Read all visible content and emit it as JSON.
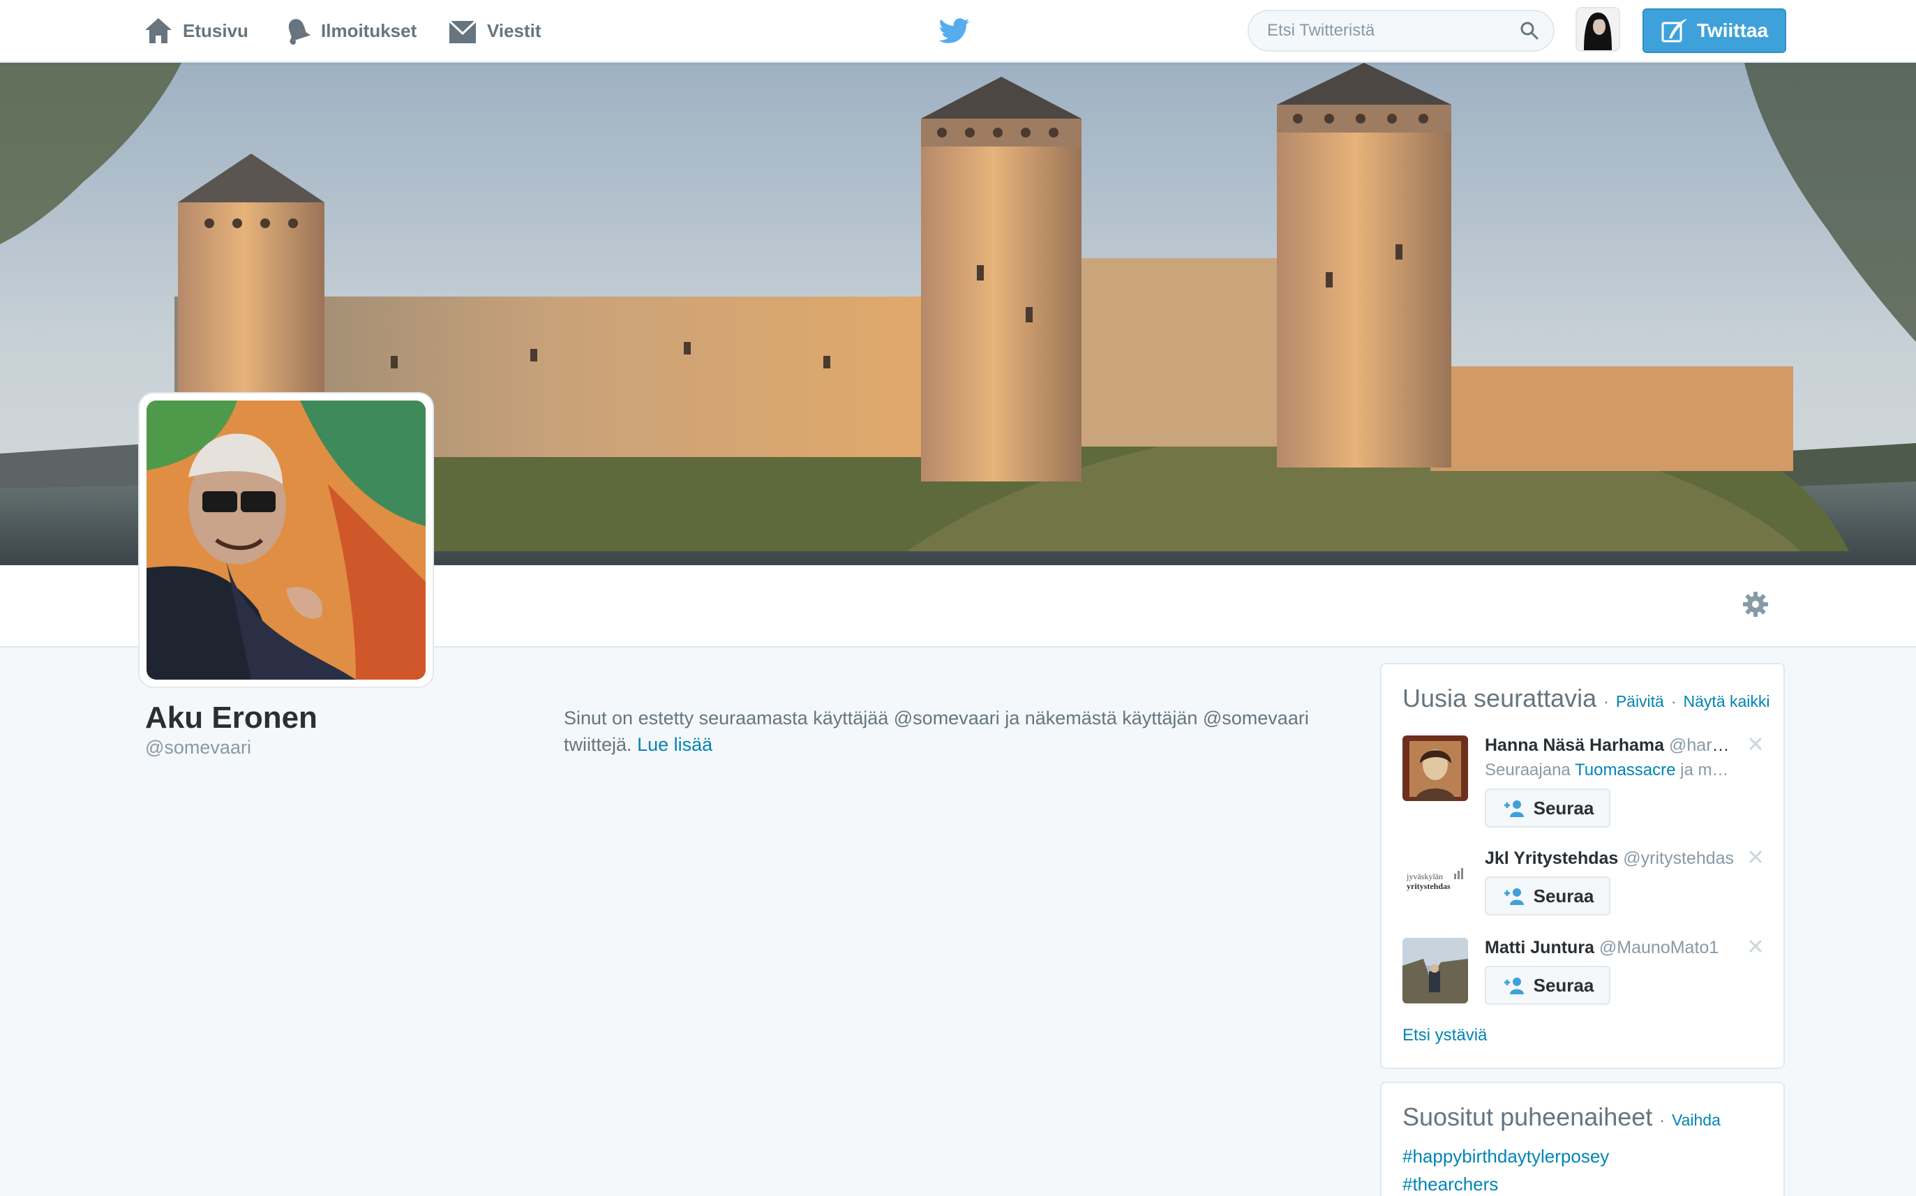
{
  "topbar": {
    "nav": {
      "home_label": "Etusivu",
      "notifications_label": "Ilmoitukset",
      "messages_label": "Viestit"
    },
    "search_placeholder": "Etsi Twitteristä",
    "tweet_button_label": "Twiittaa"
  },
  "profile": {
    "name": "Aku Eronen",
    "handle": "@somevaari",
    "blocked_message": "Sinut on estetty seuraamasta käyttäjää @somevaari ja näkemästä käyttäjän @somevaari twiittejä.",
    "learn_more_label": "Lue lisää"
  },
  "who_to_follow": {
    "title": "Uusia seurattavia",
    "separator": "·",
    "refresh_label": "Päivitä",
    "view_all_label": "Näytä kaikki",
    "users": [
      {
        "name": "Hanna Näsä Harhama",
        "handle": "@harhama",
        "followed_by_prefix": "Seuraajana",
        "followed_by_name": "Tuomassacre",
        "followed_by_suffix": "ja muita",
        "follow_label": "Seuraa"
      },
      {
        "name": "Jkl Yritystehdas",
        "handle": "@yritystehdas",
        "logo_text_line1": "jyväskylän",
        "logo_text_line2": "yritystehdas",
        "follow_label": "Seuraa"
      },
      {
        "name": "Matti Juntura",
        "handle": "@MaunoMato1",
        "follow_label": "Seuraa"
      }
    ],
    "find_friends_label": "Etsi ystäviä"
  },
  "trends": {
    "title": "Suositut puheenaiheet",
    "separator": "·",
    "change_label": "Vaihda",
    "items": [
      "#happybirthdaytylerposey",
      "#thearchers"
    ]
  },
  "colors": {
    "brand_blue": "#55acee",
    "link_blue": "#0084b4",
    "tweet_button": "#3ea1d9",
    "muted_text": "#8899a6"
  },
  "icons": {
    "home": "home-icon",
    "notifications": "bell-icon",
    "messages": "envelope-icon",
    "brand": "twitter-bird-icon",
    "search": "search-icon",
    "tweet": "compose-quill-icon",
    "settings": "gear-icon",
    "follow": "add-user-icon",
    "dismiss": "close-icon"
  }
}
